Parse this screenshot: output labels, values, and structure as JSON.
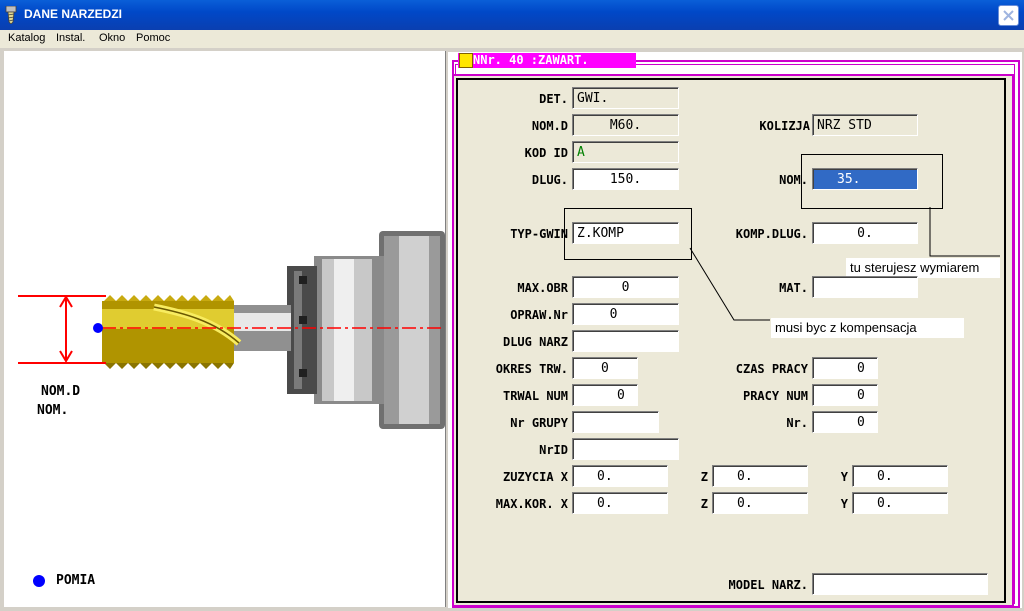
{
  "window": {
    "title": "DANE NARZEDZI",
    "icon": "tool-icon"
  },
  "menu": [
    "Katalog",
    "Instal.",
    "Okno",
    "Pomoc"
  ],
  "left": {
    "nom_d_label": "NOM.D",
    "nom_label": "NOM.",
    "legend_label": "POMIA",
    "legend_color": "#0000ff"
  },
  "tab": {
    "title": "NNr. 40 :ZAWART."
  },
  "fields": {
    "det": {
      "label": "DET.",
      "value": "GWI."
    },
    "nom_d": {
      "label": "NOM.D",
      "value": "M60."
    },
    "kod_id": {
      "label": "KOD ID",
      "value": "A"
    },
    "dlug": {
      "label": "DLUG.",
      "value": "150."
    },
    "kolizja": {
      "label": "KOLIZJA",
      "value": "NRZ STD"
    },
    "nom": {
      "label": "NOM.",
      "value": "35."
    },
    "typ_gwin": {
      "label": "TYP-GWIN",
      "value": "Z.KOMP"
    },
    "komp_dlug": {
      "label": "KOMP.DLUG.",
      "value": "0."
    },
    "max_obr": {
      "label": "MAX.OBR",
      "value": "0"
    },
    "mat": {
      "label": "MAT.",
      "value": ""
    },
    "opraw_nr": {
      "label": "OPRAW.Nr",
      "value": "0"
    },
    "dlug_narz": {
      "label": "DLUG NARZ",
      "value": ""
    },
    "okres_trw": {
      "label": "OKRES TRW.",
      "value": "0"
    },
    "czas_pracy": {
      "label": "CZAS PRACY",
      "value": "0"
    },
    "trwal_num": {
      "label": "TRWAL NUM",
      "value": "0"
    },
    "pracy_num": {
      "label": "PRACY NUM",
      "value": "0"
    },
    "nr_grupy": {
      "label": "Nr GRUPY",
      "value": ""
    },
    "nr": {
      "label": "Nr.",
      "value": "0"
    },
    "nrid": {
      "label": "NrID",
      "value": ""
    },
    "zuzycia": {
      "label": "ZUZYCIA X",
      "x": "0.",
      "z_label": "Z",
      "z": "0.",
      "y_label": "Y",
      "y": "0."
    },
    "max_kor": {
      "label": "MAX.KOR. X",
      "x": "0.",
      "z_label": "Z",
      "z": "0.",
      "y_label": "Y",
      "y": "0."
    },
    "model_narz": {
      "label": "MODEL NARZ.",
      "value": ""
    }
  },
  "callouts": {
    "nom_note": "tu sterujesz wymiarem",
    "typ_note": "musi byc z kompensacja"
  },
  "colors": {
    "title_bar": "#0048c8",
    "tab_header": "#ff00ff",
    "selection": "#316ac5",
    "dimension_red": "#ff0000",
    "thread_gold": "#d4b800"
  }
}
